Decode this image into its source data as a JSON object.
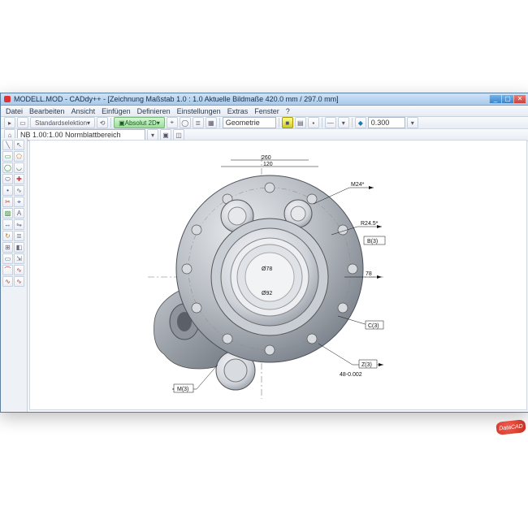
{
  "window": {
    "title": "MODELL.MOD  -  CADdy++ - [Zeichnung    Maßstab 1.0 : 1.0   Aktuelle Bildmaße 420.0 mm / 297.0 mm]"
  },
  "menubar": {
    "items": [
      "Datei",
      "Bearbeiten",
      "Ansicht",
      "Einfügen",
      "Definieren",
      "Einstellungen",
      "Extras",
      "Fenster",
      "?"
    ]
  },
  "toolbar1": {
    "mode_label": "Standardselektion",
    "absolut2d_label": "Absolut 2D",
    "combo_label": "Geometrie",
    "value_field": "0.300"
  },
  "toolbar2": {
    "scale_field": "NB 1.00:1.00 Normblattbereich"
  },
  "left_tools": {
    "items": [
      "✎",
      "↘",
      "◯",
      "□",
      "◇",
      "◯",
      "◯",
      "⌂",
      "∿",
      "+",
      "⊕",
      "⌖",
      "◐",
      "✚",
      "◯",
      "↻",
      "A",
      "≡",
      "⇄",
      "⊞",
      "◧",
      "▭",
      "⇲",
      "⌒",
      "∿",
      "∿"
    ]
  },
  "drawing": {
    "callouts": [
      "M24*",
      "B(3)",
      "R24.5*",
      "78",
      "C(3)",
      "Z(3)",
      "48–0.002",
      "M(3)"
    ],
    "dim_labels": [
      "Ø78",
      "Ø92",
      "120",
      "260"
    ]
  },
  "watermark": {
    "text": "DataCAD"
  }
}
